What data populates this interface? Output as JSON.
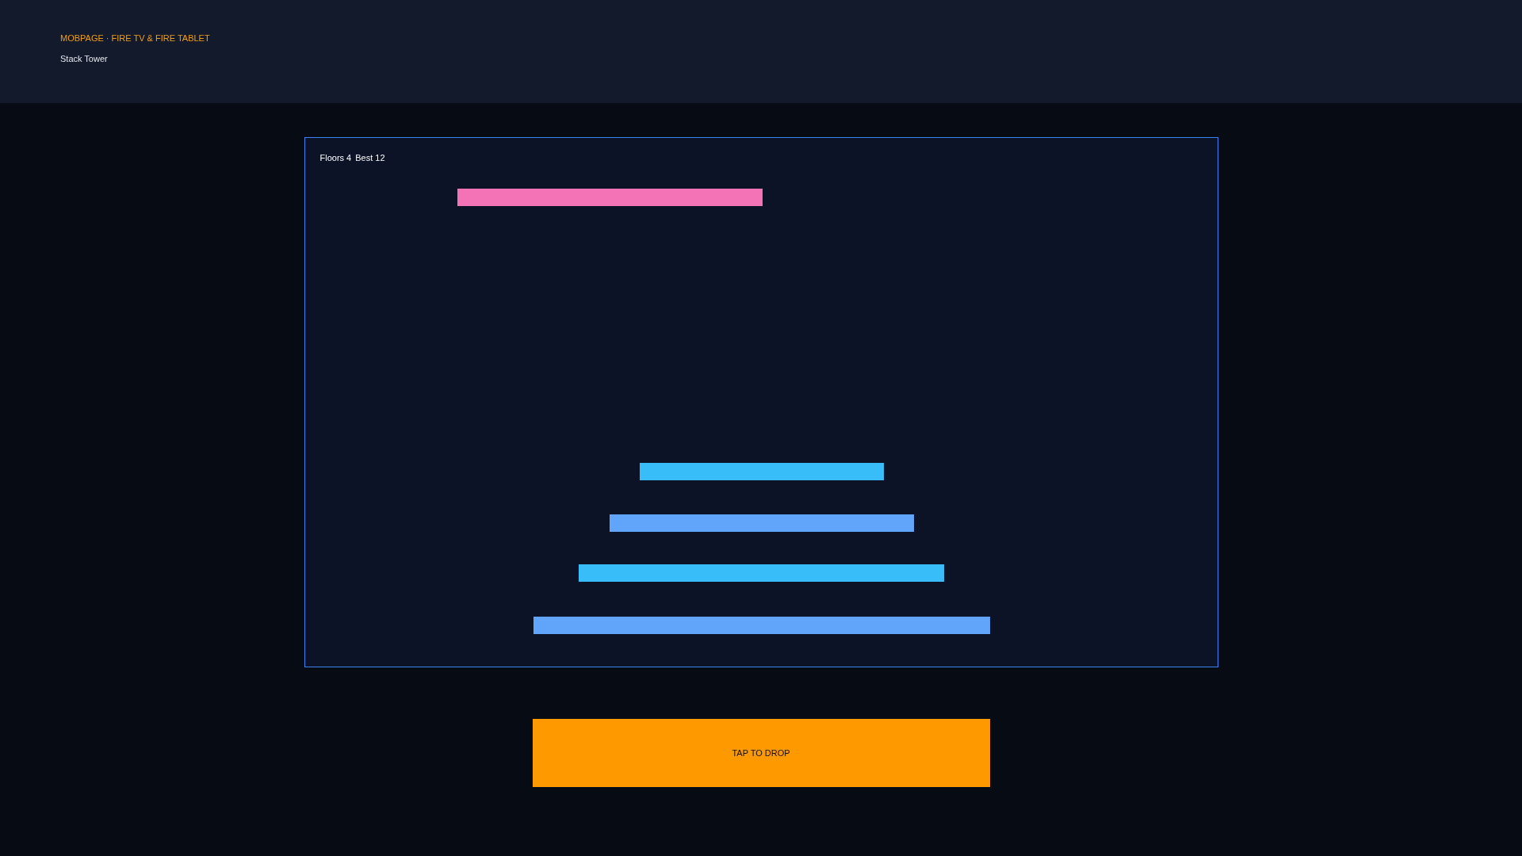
{
  "header": {
    "brand": "MOBPAGE · FIRE TV & FIRE TABLET",
    "title": "Stack Tower"
  },
  "game": {
    "floors": "Floors 4",
    "best": "Best 12",
    "blocks": [
      {
        "color": "#f472b6"
      },
      {
        "color": "#38bdf8"
      },
      {
        "color": "#60a5fa"
      },
      {
        "color": "#38bdf8"
      },
      {
        "color": "#60a5fa"
      }
    ]
  },
  "button": {
    "label": "TAP TO DROP"
  }
}
